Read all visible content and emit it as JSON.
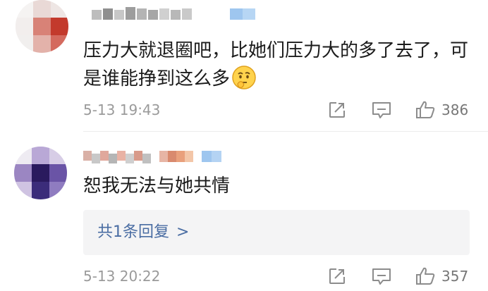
{
  "comments": [
    {
      "text": "压力大就退圈吧，比她们压力大的多了去了，可是谁能挣到这么多",
      "emoji": "thinking-emoji",
      "time": "5-13 19:43",
      "likes": "386"
    },
    {
      "text": "恕我无法与她共情",
      "reply_summary": "共1条回复",
      "reply_chevron": ">",
      "time": "5-13 20:22",
      "likes": "357"
    }
  ],
  "colors": {
    "link": "#4a6da3",
    "meta": "#9a9a9a",
    "reply_bg": "#f4f4f5"
  },
  "icons": [
    "share-icon",
    "comment-icon",
    "like-icon"
  ]
}
